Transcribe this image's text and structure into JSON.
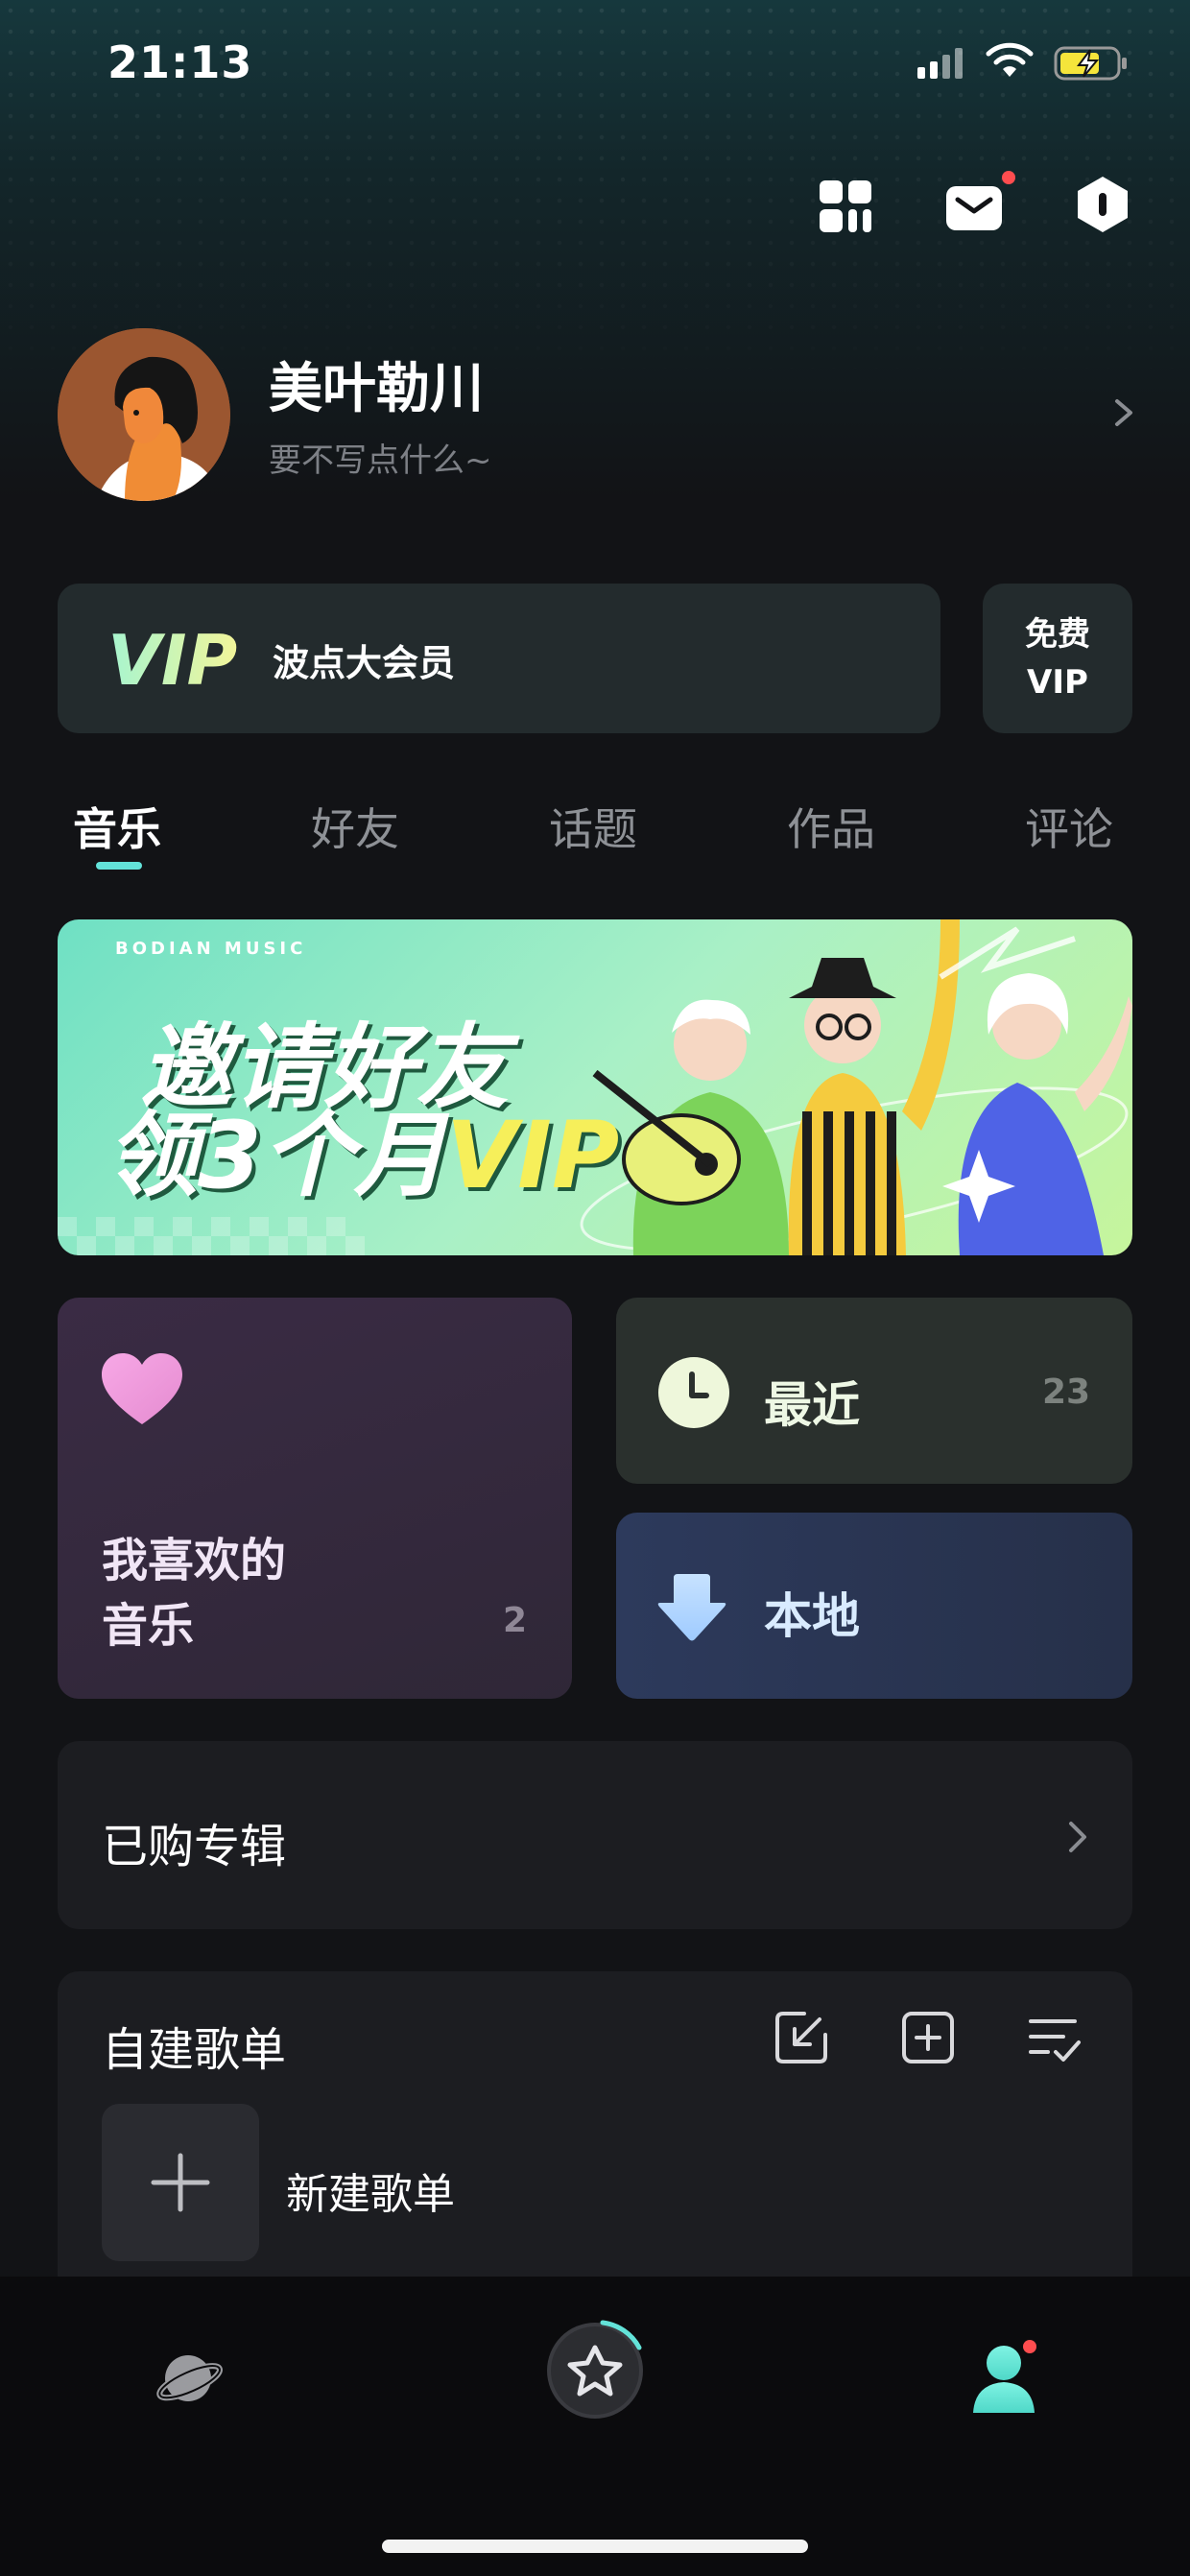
{
  "status_bar": {
    "time": "21:13"
  },
  "profile": {
    "name": "美叶勒川",
    "bio": "要不写点什么~"
  },
  "vip": {
    "logo": "VIP",
    "label": "波点大会员",
    "free_line1": "免费",
    "free_line2": "VIP"
  },
  "tabs": [
    {
      "label": "音乐",
      "active": true
    },
    {
      "label": "好友",
      "active": false
    },
    {
      "label": "话题",
      "active": false
    },
    {
      "label": "作品",
      "active": false
    },
    {
      "label": "评论",
      "active": false
    }
  ],
  "banner": {
    "brand": "BODIAN MUSIC",
    "line1": "邀请好友",
    "line2_prefix": "领3个月",
    "line2_vip": "VIP"
  },
  "cards": {
    "favorites": {
      "line1": "我喜欢的",
      "line2": "音乐",
      "count": "2"
    },
    "recent": {
      "label": "最近",
      "count": "23"
    },
    "local": {
      "label": "本地"
    }
  },
  "purchased": {
    "label": "已购专辑"
  },
  "playlists": {
    "title": "自建歌单",
    "new_label": "新建歌单"
  },
  "colors": {
    "accent": "#63e3d9",
    "notification": "#ff4d4f"
  }
}
